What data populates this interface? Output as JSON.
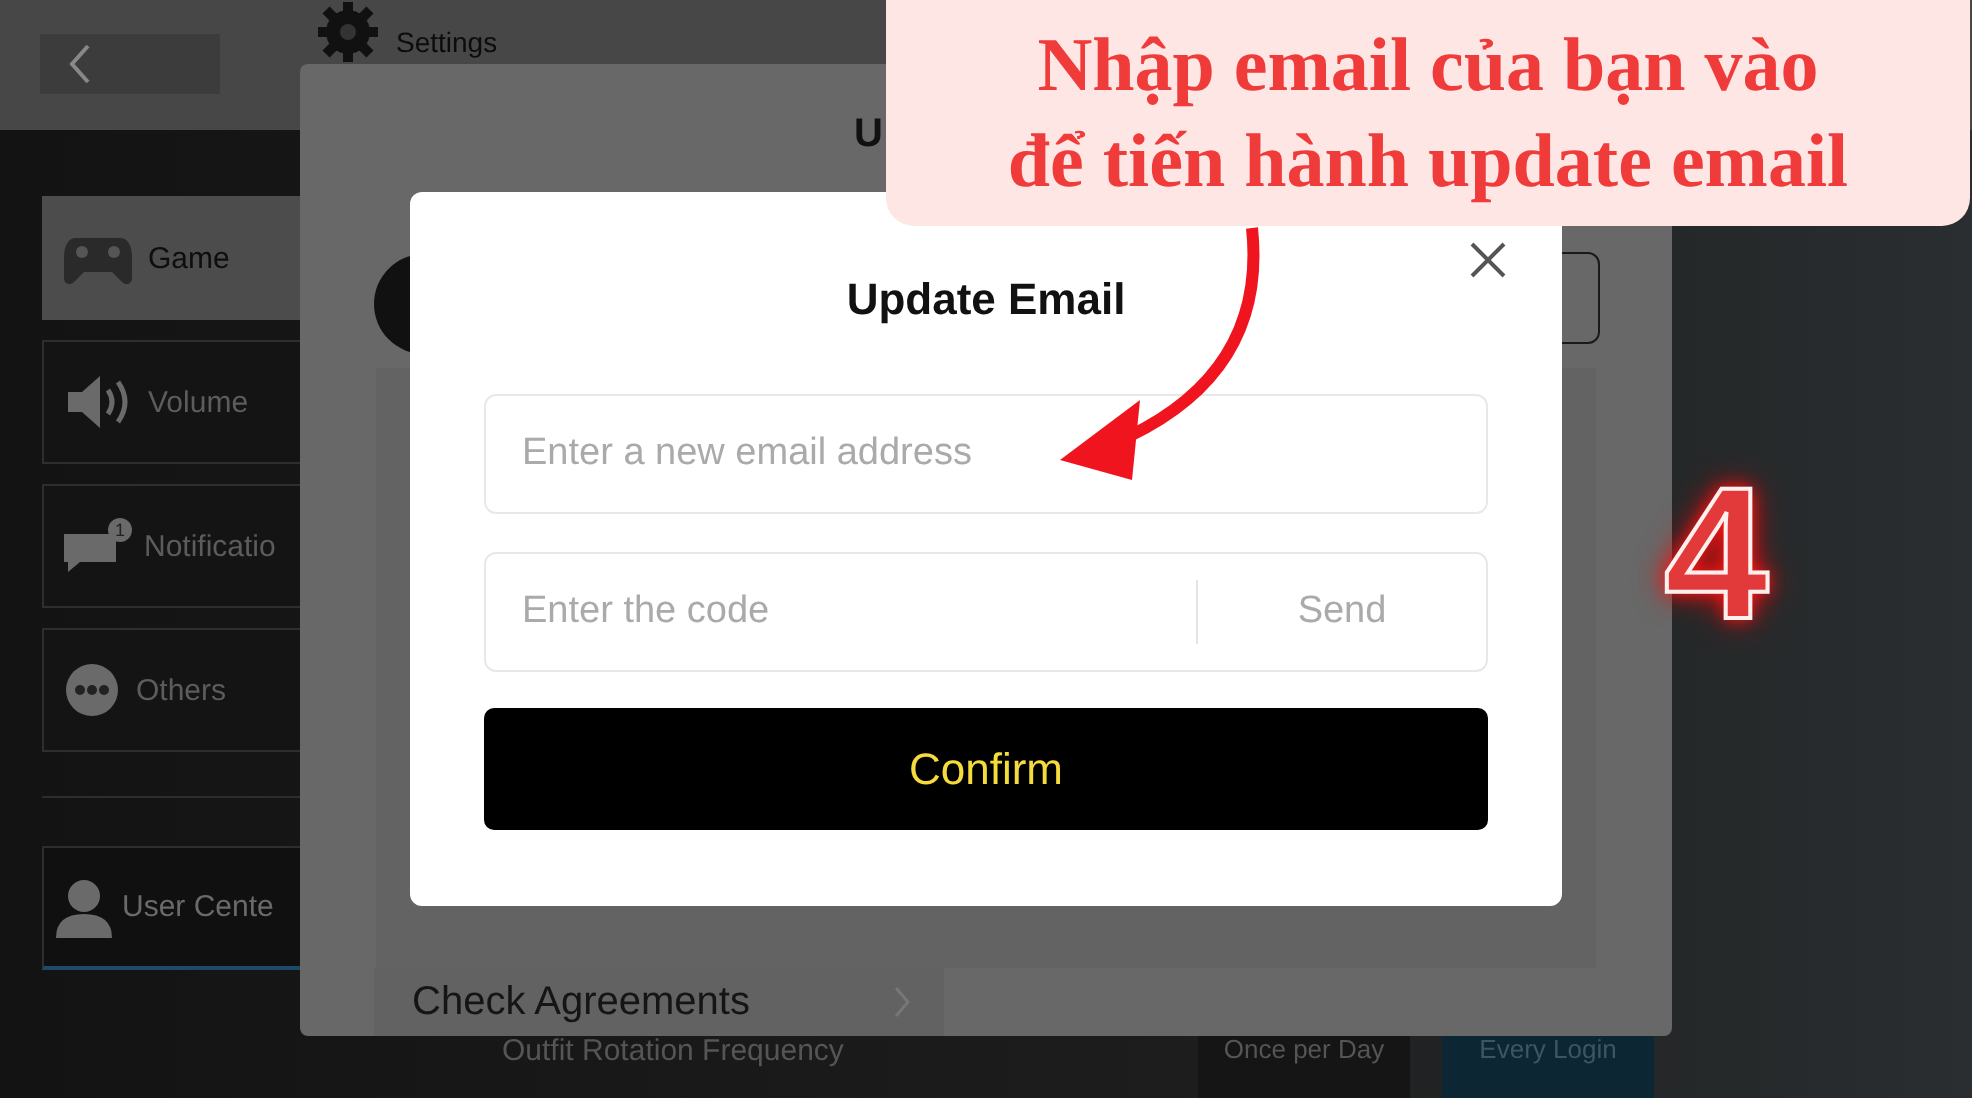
{
  "header": {
    "title": "Settings"
  },
  "sidebar": {
    "items": [
      {
        "kind": "game",
        "label": "Game",
        "selected": true
      },
      {
        "kind": "volume",
        "label": "Volume",
        "selected": false
      },
      {
        "kind": "notification",
        "label": "Notificatio",
        "badge": "1",
        "selected": false
      },
      {
        "kind": "others",
        "label": "Others",
        "selected": false
      },
      {
        "kind": "user",
        "label": "User Cente",
        "selected": false
      }
    ]
  },
  "panel": {
    "title": "U",
    "rows": [
      {
        "label": "Check Agreements"
      }
    ]
  },
  "background_section": {
    "label": "Outfit Rotation Frequency",
    "options": [
      {
        "label": "Once per Day",
        "selected": false
      },
      {
        "label": "Every Login",
        "selected": true
      }
    ]
  },
  "dialog": {
    "title": "Update Email",
    "email_field": {
      "placeholder": "Enter a new email address"
    },
    "code_field": {
      "placeholder": "Enter the code"
    },
    "send_button": "Send",
    "confirm_button": "Confirm"
  },
  "annotation": {
    "lines": [
      "Nhập email của bạn vào",
      "để tiến hành update email"
    ],
    "step": "4"
  }
}
